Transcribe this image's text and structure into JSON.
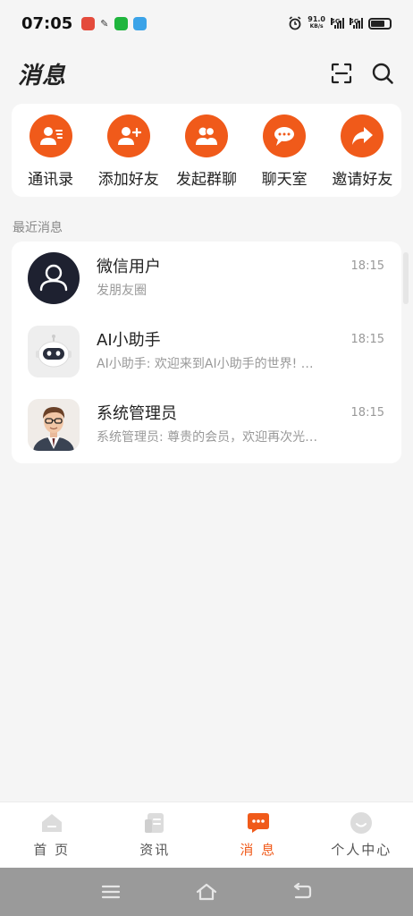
{
  "status_bar": {
    "time": "07:05",
    "net_speed": "91.0",
    "net_speed_unit": "KB/s",
    "signal_1": "5G",
    "signal_2": "5G",
    "battery_level": 0.75
  },
  "header": {
    "title": "消息",
    "scan_icon": "scan-icon",
    "search_icon": "search-icon"
  },
  "quick_actions": [
    {
      "label": "通讯录",
      "icon": "contacts-icon"
    },
    {
      "label": "添加好友",
      "icon": "add-friend-icon"
    },
    {
      "label": "发起群聊",
      "icon": "group-chat-icon"
    },
    {
      "label": "聊天室",
      "icon": "chat-room-icon"
    },
    {
      "label": "邀请好友",
      "icon": "share-icon"
    }
  ],
  "recent_label": "最近消息",
  "messages": [
    {
      "name": "微信用户",
      "preview": "发朋友圈",
      "time": "18:15",
      "avatar": "user-avatar"
    },
    {
      "name": "AI小助手",
      "preview": "AI小助手: 欢迎来到AI小助手的世界! …",
      "time": "18:15",
      "avatar": "robot-avatar"
    },
    {
      "name": "系统管理员",
      "preview": "系统管理员: 尊贵的会员，欢迎再次光…",
      "time": "18:15",
      "avatar": "admin-avatar"
    }
  ],
  "tabs": [
    {
      "label": "首 页",
      "icon": "home-icon",
      "active": false
    },
    {
      "label": "资讯",
      "icon": "news-icon",
      "active": false
    },
    {
      "label": "消 息",
      "icon": "message-icon",
      "active": true
    },
    {
      "label": "个人中心",
      "icon": "profile-icon",
      "active": false
    }
  ],
  "colors": {
    "accent": "#f05a1a",
    "background": "#f5f5f5"
  }
}
